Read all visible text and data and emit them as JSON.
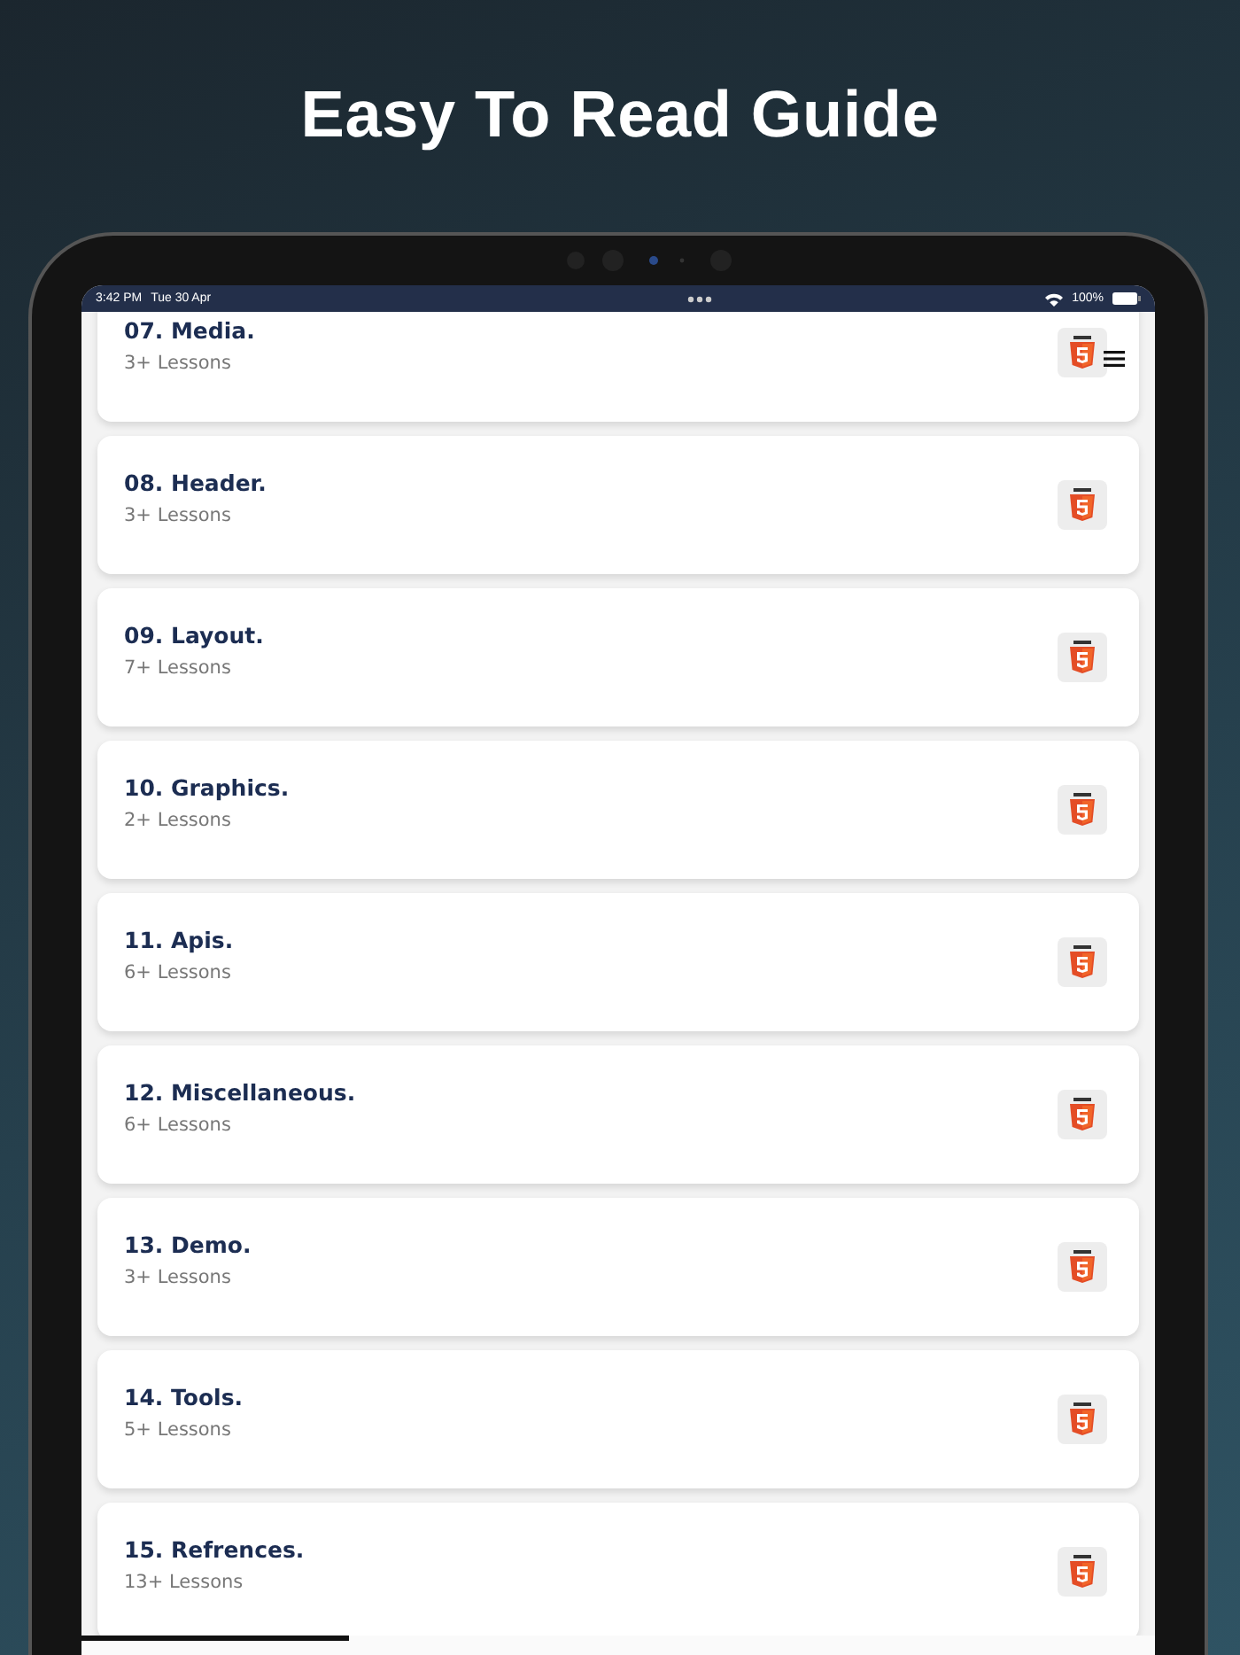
{
  "headline": "Easy To Read Guide",
  "status_bar": {
    "time": "3:42 PM",
    "date": "Tue 30 Apr",
    "battery": "100%"
  },
  "lessons": [
    {
      "title": "07. Media.",
      "count": "3+ Lessons"
    },
    {
      "title": "08. Header.",
      "count": "3+ Lessons"
    },
    {
      "title": "09. Layout.",
      "count": "7+ Lessons"
    },
    {
      "title": "10. Graphics.",
      "count": "2+ Lessons"
    },
    {
      "title": "11. Apis.",
      "count": "6+ Lessons"
    },
    {
      "title": "12. Miscellaneous.",
      "count": "6+ Lessons"
    },
    {
      "title": "13. Demo.",
      "count": "3+ Lessons"
    },
    {
      "title": "14. Tools.",
      "count": "5+ Lessons"
    },
    {
      "title": "15. Refrences.",
      "count": "13+ Lessons"
    }
  ]
}
